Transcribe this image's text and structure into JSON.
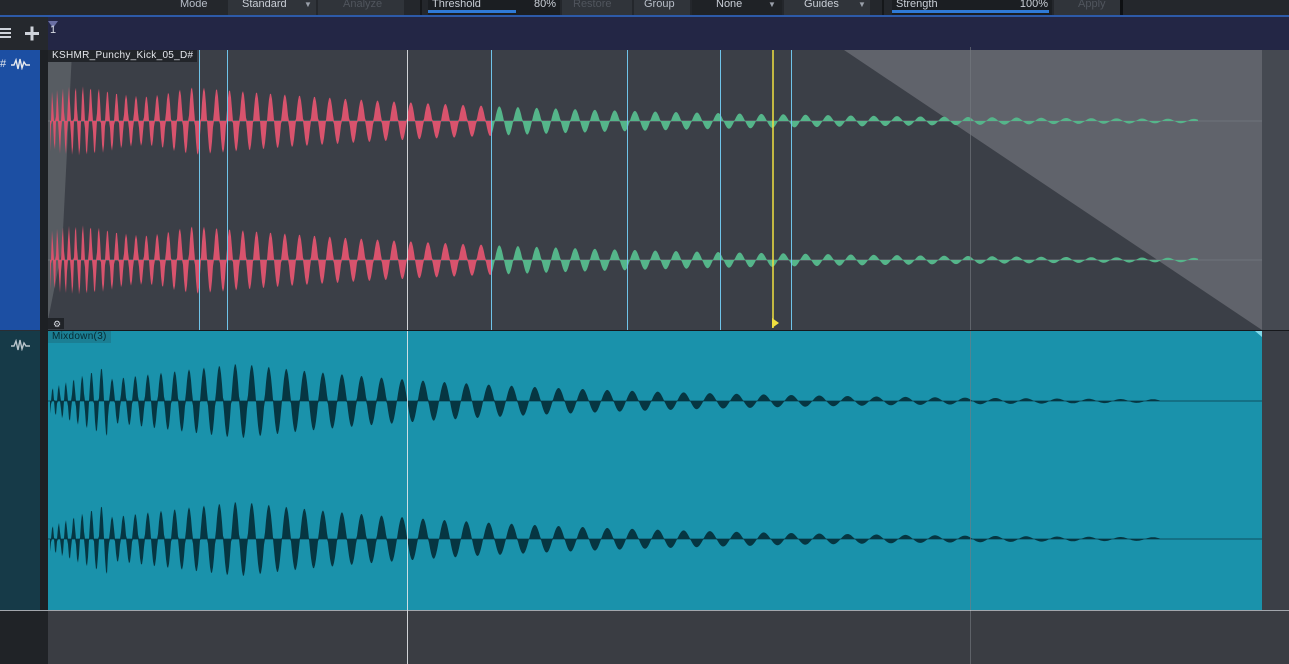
{
  "toolbar": {
    "mode_label": "Mode",
    "mode_value": "Standard",
    "analyze": "Analyze",
    "threshold_label": "Threshold",
    "threshold_value": "80%",
    "threshold_fraction": 0.8,
    "restore": "Restore",
    "group_label": "Group",
    "group_value": "None",
    "guides": "Guides",
    "strength_label": "Strength",
    "strength_value": "100%",
    "strength_fraction": 1.0,
    "apply": "Apply"
  },
  "ruler": {
    "bar_number": "1"
  },
  "tracks": [
    {
      "clip_name": "KSHMR_Punchy_Kick_05_D#",
      "header_symbol": "#",
      "icon": "waveform-icon"
    },
    {
      "clip_name": "Mixdown(3)",
      "icon": "waveform-icon"
    }
  ],
  "colors": {
    "accent_blue": "#2f7ad6",
    "track1_header": "#1c4fa3",
    "waveform_red": "#d8536d",
    "waveform_green": "#55b58a",
    "mixdown_clip": "#1a92ab",
    "playhead": "#f0e040"
  }
}
